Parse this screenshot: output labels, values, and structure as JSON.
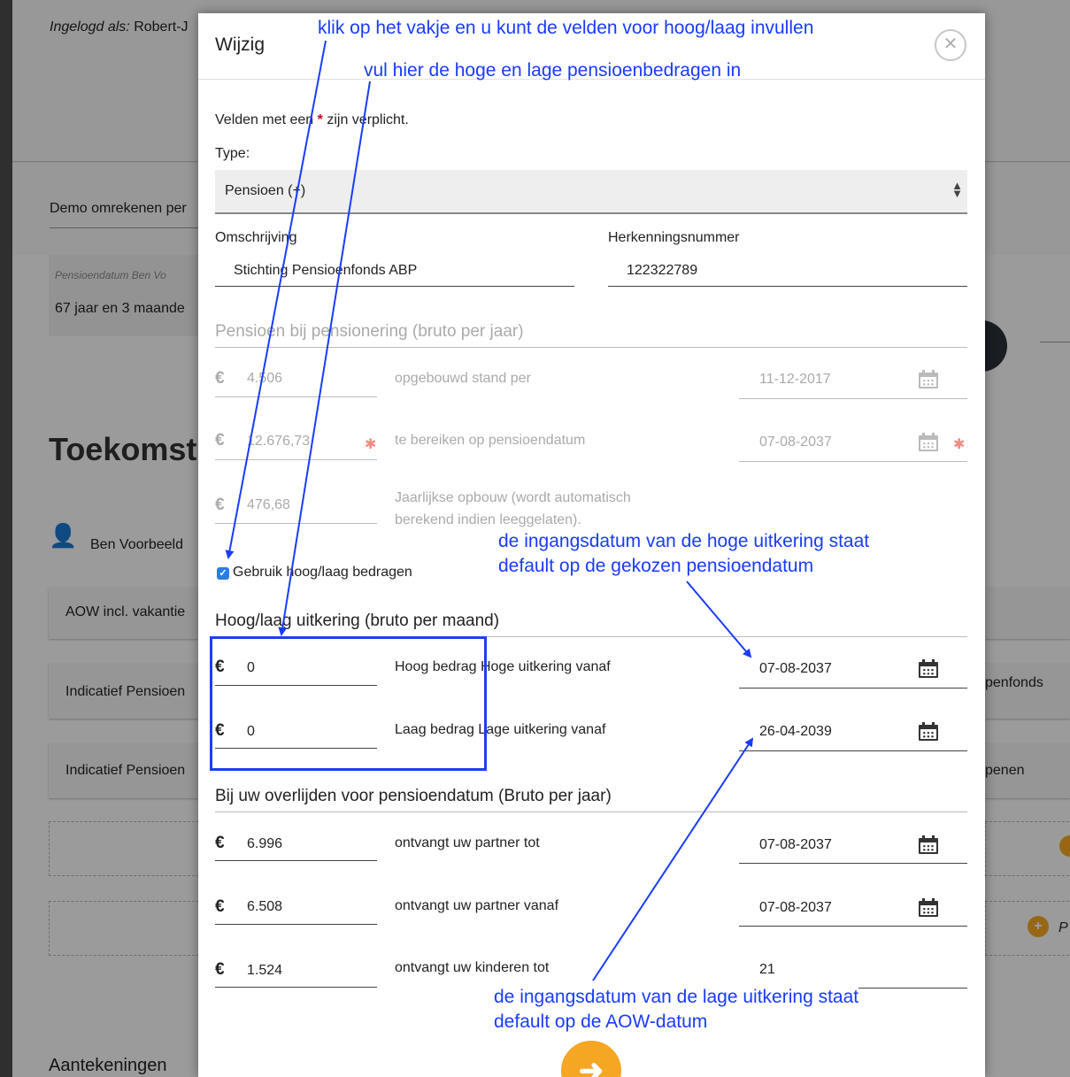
{
  "background": {
    "logged_in_label": "Ingelogd als:",
    "logged_in_user": "Robert-J",
    "demo_text": "Demo omrekenen per",
    "pension_date_label": "Pensioendatum Ben Vo",
    "pension_date_value": "67 jaar en 3 maande",
    "section_title": "Toekomst",
    "person_name": "Ben Voorbeeld",
    "cards": [
      "AOW incl. vakantie",
      "Indicatief Pensioen",
      "Indicatief Pensioen"
    ],
    "right_texts": [
      "penfonds",
      "penen",
      "P"
    ],
    "notes_title": "Aantekeningen"
  },
  "modal": {
    "title": "Wijzig",
    "required_note_prefix": "Velden met een",
    "required_star": "*",
    "required_note_suffix": "zijn verplicht.",
    "type_label": "Type:",
    "type_value": "Pensioen (+)",
    "omschrijving_label": "Omschrijving",
    "omschrijving_value": "Stichting Pensioenfonds ABP",
    "herkenning_label": "Herkenningsnummer",
    "herkenning_value": "122322789",
    "section_pension": "Pensioen bij pensionering (bruto per jaar)",
    "currency": "€",
    "rows_pension": [
      {
        "amount": "4.506",
        "label": "opgebouwd stand per",
        "date": "11-12-2017"
      },
      {
        "amount": "12.676,73",
        "label": "te bereiken op pensioendatum",
        "date": "07-08-2037"
      },
      {
        "amount": "476,68",
        "label": "Jaarlijkse opbouw (wordt automatisch",
        "label2": "berekend indien leeggelaten)."
      }
    ],
    "checkbox_label": "Gebruik hoog/laag bedragen",
    "section_hooglaag": "Hoog/laag uitkering (bruto per maand)",
    "rows_hooglaag": [
      {
        "amount": "0",
        "label": "Hoog bedrag Hoge uitkering vanaf",
        "date": "07-08-2037"
      },
      {
        "amount": "0",
        "label": "Laag bedrag Lage uitkering vanaf",
        "date": "26-04-2039"
      }
    ],
    "section_overlijden": "Bij uw overlijden voor pensioendatum (Bruto per jaar)",
    "rows_overlijden": [
      {
        "amount": "6.996",
        "label": "ontvangt uw partner tot",
        "date": "07-08-2037"
      },
      {
        "amount": "6.508",
        "label": "ontvangt uw partner vanaf",
        "date": "07-08-2037"
      },
      {
        "amount": "1.524",
        "label": "ontvangt uw kinderen tot",
        "date": "21"
      }
    ]
  },
  "annotations": {
    "a1": "klik op het vakje en u kunt de velden voor hoog/laag invullen",
    "a2": "vul hier de hoge en lage pensioenbedragen in",
    "a3_1": "de ingangsdatum van de hoge uitkering staat",
    "a3_2": "default op de gekozen pensioendatum",
    "a4_1": "de ingangsdatum van de lage uitkering staat",
    "a4_2": "default op de AOW-datum",
    "color": "#1a3bff"
  }
}
